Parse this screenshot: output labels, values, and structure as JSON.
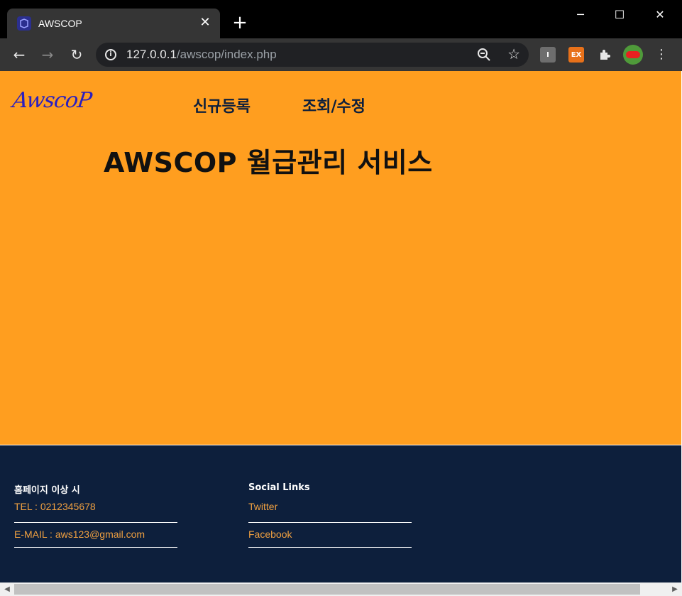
{
  "browser": {
    "tab_title": "AWSCOP",
    "tab_close": "✕",
    "new_tab": "+",
    "url_host": "127.0.0.1",
    "url_path": "/awscop/index.php",
    "window_controls": {
      "minimize": "─",
      "maximize": "☐",
      "close": "✕"
    },
    "nav": {
      "back": "←",
      "forward": "→",
      "reload": "↻"
    },
    "extensions": {
      "ext1": "I",
      "ext2": "EX",
      "puzzle": "✱"
    },
    "menu": "⋮"
  },
  "page": {
    "logo": "AwscoP",
    "nav_links": [
      "신규등록",
      "조회/수정"
    ],
    "headline": "AWSCOP 월급관리 서비스",
    "footer": {
      "col1": {
        "heading": "홈페이지 이상 시",
        "items": [
          "TEL : 0212345678",
          "E-MAIL : aws123@gmail.com"
        ]
      },
      "col2": {
        "heading": "Social Links",
        "items": [
          "Twitter",
          "Facebook"
        ]
      }
    }
  },
  "colors": {
    "main_bg": "#ff9e1f",
    "footer_bg": "#0d1f3c",
    "footer_link": "#f0a040",
    "logo": "#2a1fc0"
  }
}
